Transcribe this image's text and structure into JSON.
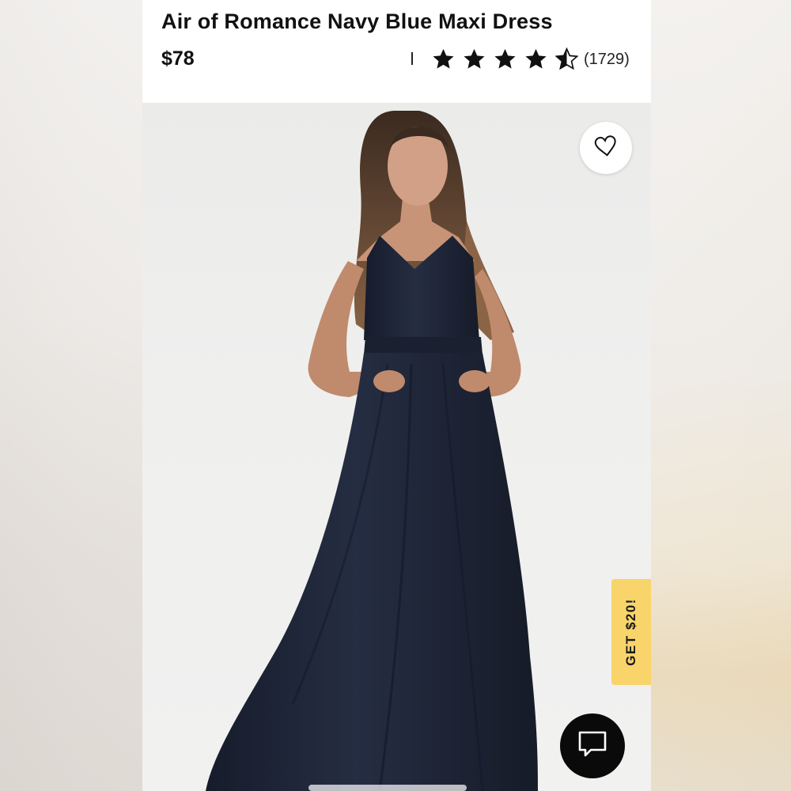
{
  "product": {
    "title": "Air of Romance Navy Blue Maxi Dress",
    "price": "$78",
    "rating": 4.5,
    "rating_max": 5,
    "review_count": "(1729)"
  },
  "actions": {
    "favorite_icon": "heart-outline-icon",
    "promo_label": "GET $20!",
    "chat_icon": "chat-bubble-icon"
  },
  "colors": {
    "dress": "#1f2638",
    "promo": "#f8d46a",
    "chat_button": "#0a0a0a"
  }
}
